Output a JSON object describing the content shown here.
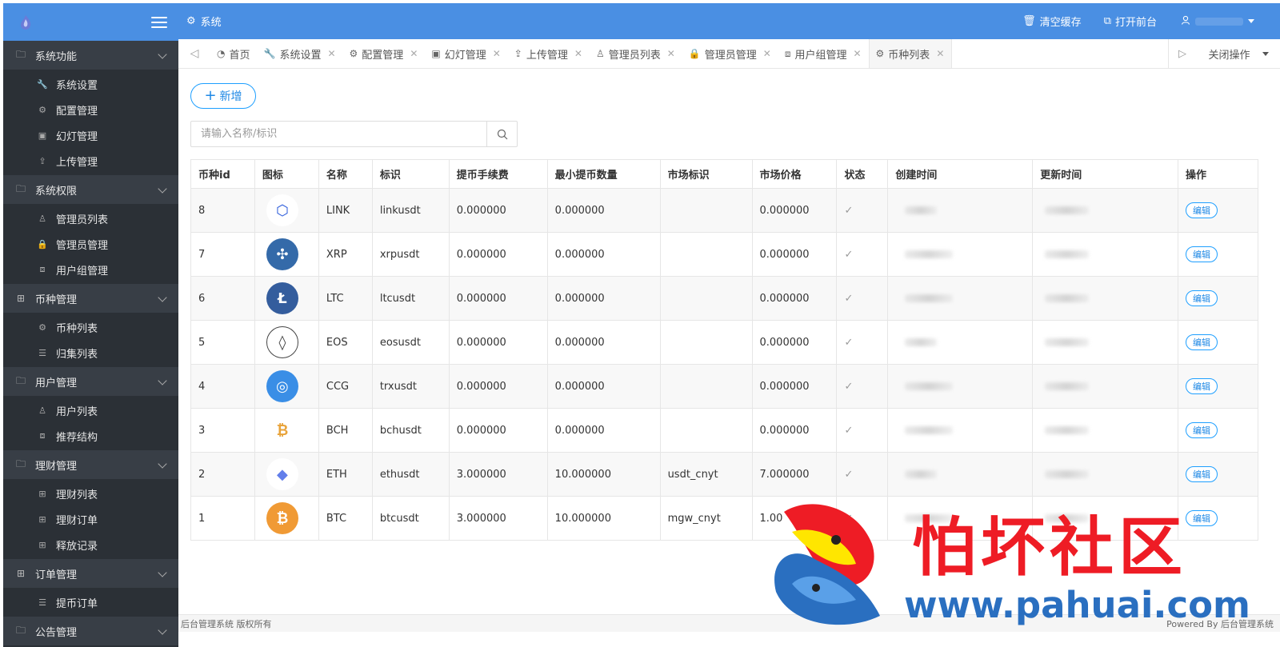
{
  "header": {
    "system_label": "系统",
    "clear_cache": "清空缓存",
    "open_frontend": "打开前台"
  },
  "sidebar": {
    "groups": [
      {
        "label": "系统功能",
        "icon": "folder-icon",
        "items": [
          {
            "label": "系统设置",
            "icon": "wrench-icon"
          },
          {
            "label": "配置管理",
            "icon": "gears-icon"
          },
          {
            "label": "幻灯管理",
            "icon": "image-icon"
          },
          {
            "label": "上传管理",
            "icon": "upload-icon"
          }
        ]
      },
      {
        "label": "系统权限",
        "icon": "folder-icon",
        "items": [
          {
            "label": "管理员列表",
            "icon": "user-icon"
          },
          {
            "label": "管理员管理",
            "icon": "lock-icon"
          },
          {
            "label": "用户组管理",
            "icon": "sitemap-icon"
          }
        ]
      },
      {
        "label": "币种管理",
        "icon": "grid-icon",
        "items": [
          {
            "label": "币种列表",
            "icon": "gears-icon"
          },
          {
            "label": "归集列表",
            "icon": "list-icon"
          }
        ]
      },
      {
        "label": "用户管理",
        "icon": "folder-icon",
        "items": [
          {
            "label": "用户列表",
            "icon": "user-icon"
          },
          {
            "label": "推荐结构",
            "icon": "sitemap-icon"
          }
        ]
      },
      {
        "label": "理财管理",
        "icon": "folder-icon",
        "items": [
          {
            "label": "理财列表",
            "icon": "grid-icon"
          },
          {
            "label": "理财订单",
            "icon": "grid-icon"
          },
          {
            "label": "释放记录",
            "icon": "grid-icon"
          }
        ]
      },
      {
        "label": "订单管理",
        "icon": "grid-icon",
        "items": [
          {
            "label": "提币订单",
            "icon": "list-icon"
          }
        ]
      },
      {
        "label": "公告管理",
        "icon": "folder-icon",
        "items": []
      }
    ]
  },
  "tabs": [
    {
      "label": "首页",
      "icon": "dashboard-icon",
      "closable": false
    },
    {
      "label": "系统设置",
      "icon": "wrench-icon",
      "closable": true
    },
    {
      "label": "配置管理",
      "icon": "gears-icon",
      "closable": true
    },
    {
      "label": "幻灯管理",
      "icon": "image-icon",
      "closable": true
    },
    {
      "label": "上传管理",
      "icon": "upload-icon",
      "closable": true
    },
    {
      "label": "管理员列表",
      "icon": "user-icon",
      "closable": true
    },
    {
      "label": "管理员管理",
      "icon": "lock-icon",
      "closable": true
    },
    {
      "label": "用户组管理",
      "icon": "sitemap-icon",
      "closable": true
    },
    {
      "label": "币种列表",
      "icon": "gears-icon",
      "closable": true,
      "active": true
    }
  ],
  "close_ops_label": "关闭操作",
  "toolbar": {
    "add_label": "新增",
    "search_placeholder": "请输入名称/标识"
  },
  "table": {
    "headers": [
      "币种id",
      "图标",
      "名称",
      "标识",
      "提币手续费",
      "最小提币数量",
      "市场标识",
      "市场价格",
      "状态",
      "创建时间",
      "更新时间",
      "操作"
    ],
    "edit_label": "编辑",
    "rows": [
      {
        "id": "8",
        "icon": "chainlink-icon",
        "color": "#2a5ada",
        "name": "LINK",
        "symbol": "linkusdt",
        "fee": "0.000000",
        "min": "0.000000",
        "market": "",
        "price": "0.000000"
      },
      {
        "id": "7",
        "icon": "ripple-icon",
        "color": "#346aa9",
        "name": "XRP",
        "symbol": "xrpusdt",
        "fee": "0.000000",
        "min": "0.000000",
        "market": "",
        "price": "0.000000"
      },
      {
        "id": "6",
        "icon": "litecoin-icon",
        "color": "#345d9d",
        "name": "LTC",
        "symbol": "ltcusdt",
        "fee": "0.000000",
        "min": "0.000000",
        "market": "",
        "price": "0.000000"
      },
      {
        "id": "5",
        "icon": "eos-icon",
        "color": "#444444",
        "name": "EOS",
        "symbol": "eosusdt",
        "fee": "0.000000",
        "min": "0.000000",
        "market": "",
        "price": "0.000000"
      },
      {
        "id": "4",
        "icon": "ccg-icon",
        "color": "#3a8ee6",
        "name": "CCG",
        "symbol": "trxusdt",
        "fee": "0.000000",
        "min": "0.000000",
        "market": "",
        "price": "0.000000"
      },
      {
        "id": "3",
        "icon": "bitcoin-cash-icon",
        "color": "#e8a33a",
        "name": "BCH",
        "symbol": "bchusdt",
        "fee": "0.000000",
        "min": "0.000000",
        "market": "",
        "price": "0.000000"
      },
      {
        "id": "2",
        "icon": "ethereum-icon",
        "color": "#627eea",
        "name": "ETH",
        "symbol": "ethusdt",
        "fee": "3.000000",
        "min": "10.000000",
        "market": "usdt_cnyt",
        "price": "7.000000"
      },
      {
        "id": "1",
        "icon": "bitcoin-icon",
        "color": "#f09a35",
        "name": "BTC",
        "symbol": "btcusdt",
        "fee": "3.000000",
        "min": "10.000000",
        "market": "mgw_cnyt",
        "price": "1.00"
      }
    ]
  },
  "footer": {
    "left": "后台管理系统  版权所有",
    "right": "Powered By 后台管理系统"
  },
  "watermark": {
    "title": "怕坏社区",
    "url": "www.pahuai.com"
  },
  "colors": {
    "header_blue": "#4a8fe3",
    "sidebar_dark": "#2b3036",
    "accent": "#1e9fff",
    "watermark_red": "#ee1c25",
    "watermark_blue": "#2a6fc0"
  }
}
